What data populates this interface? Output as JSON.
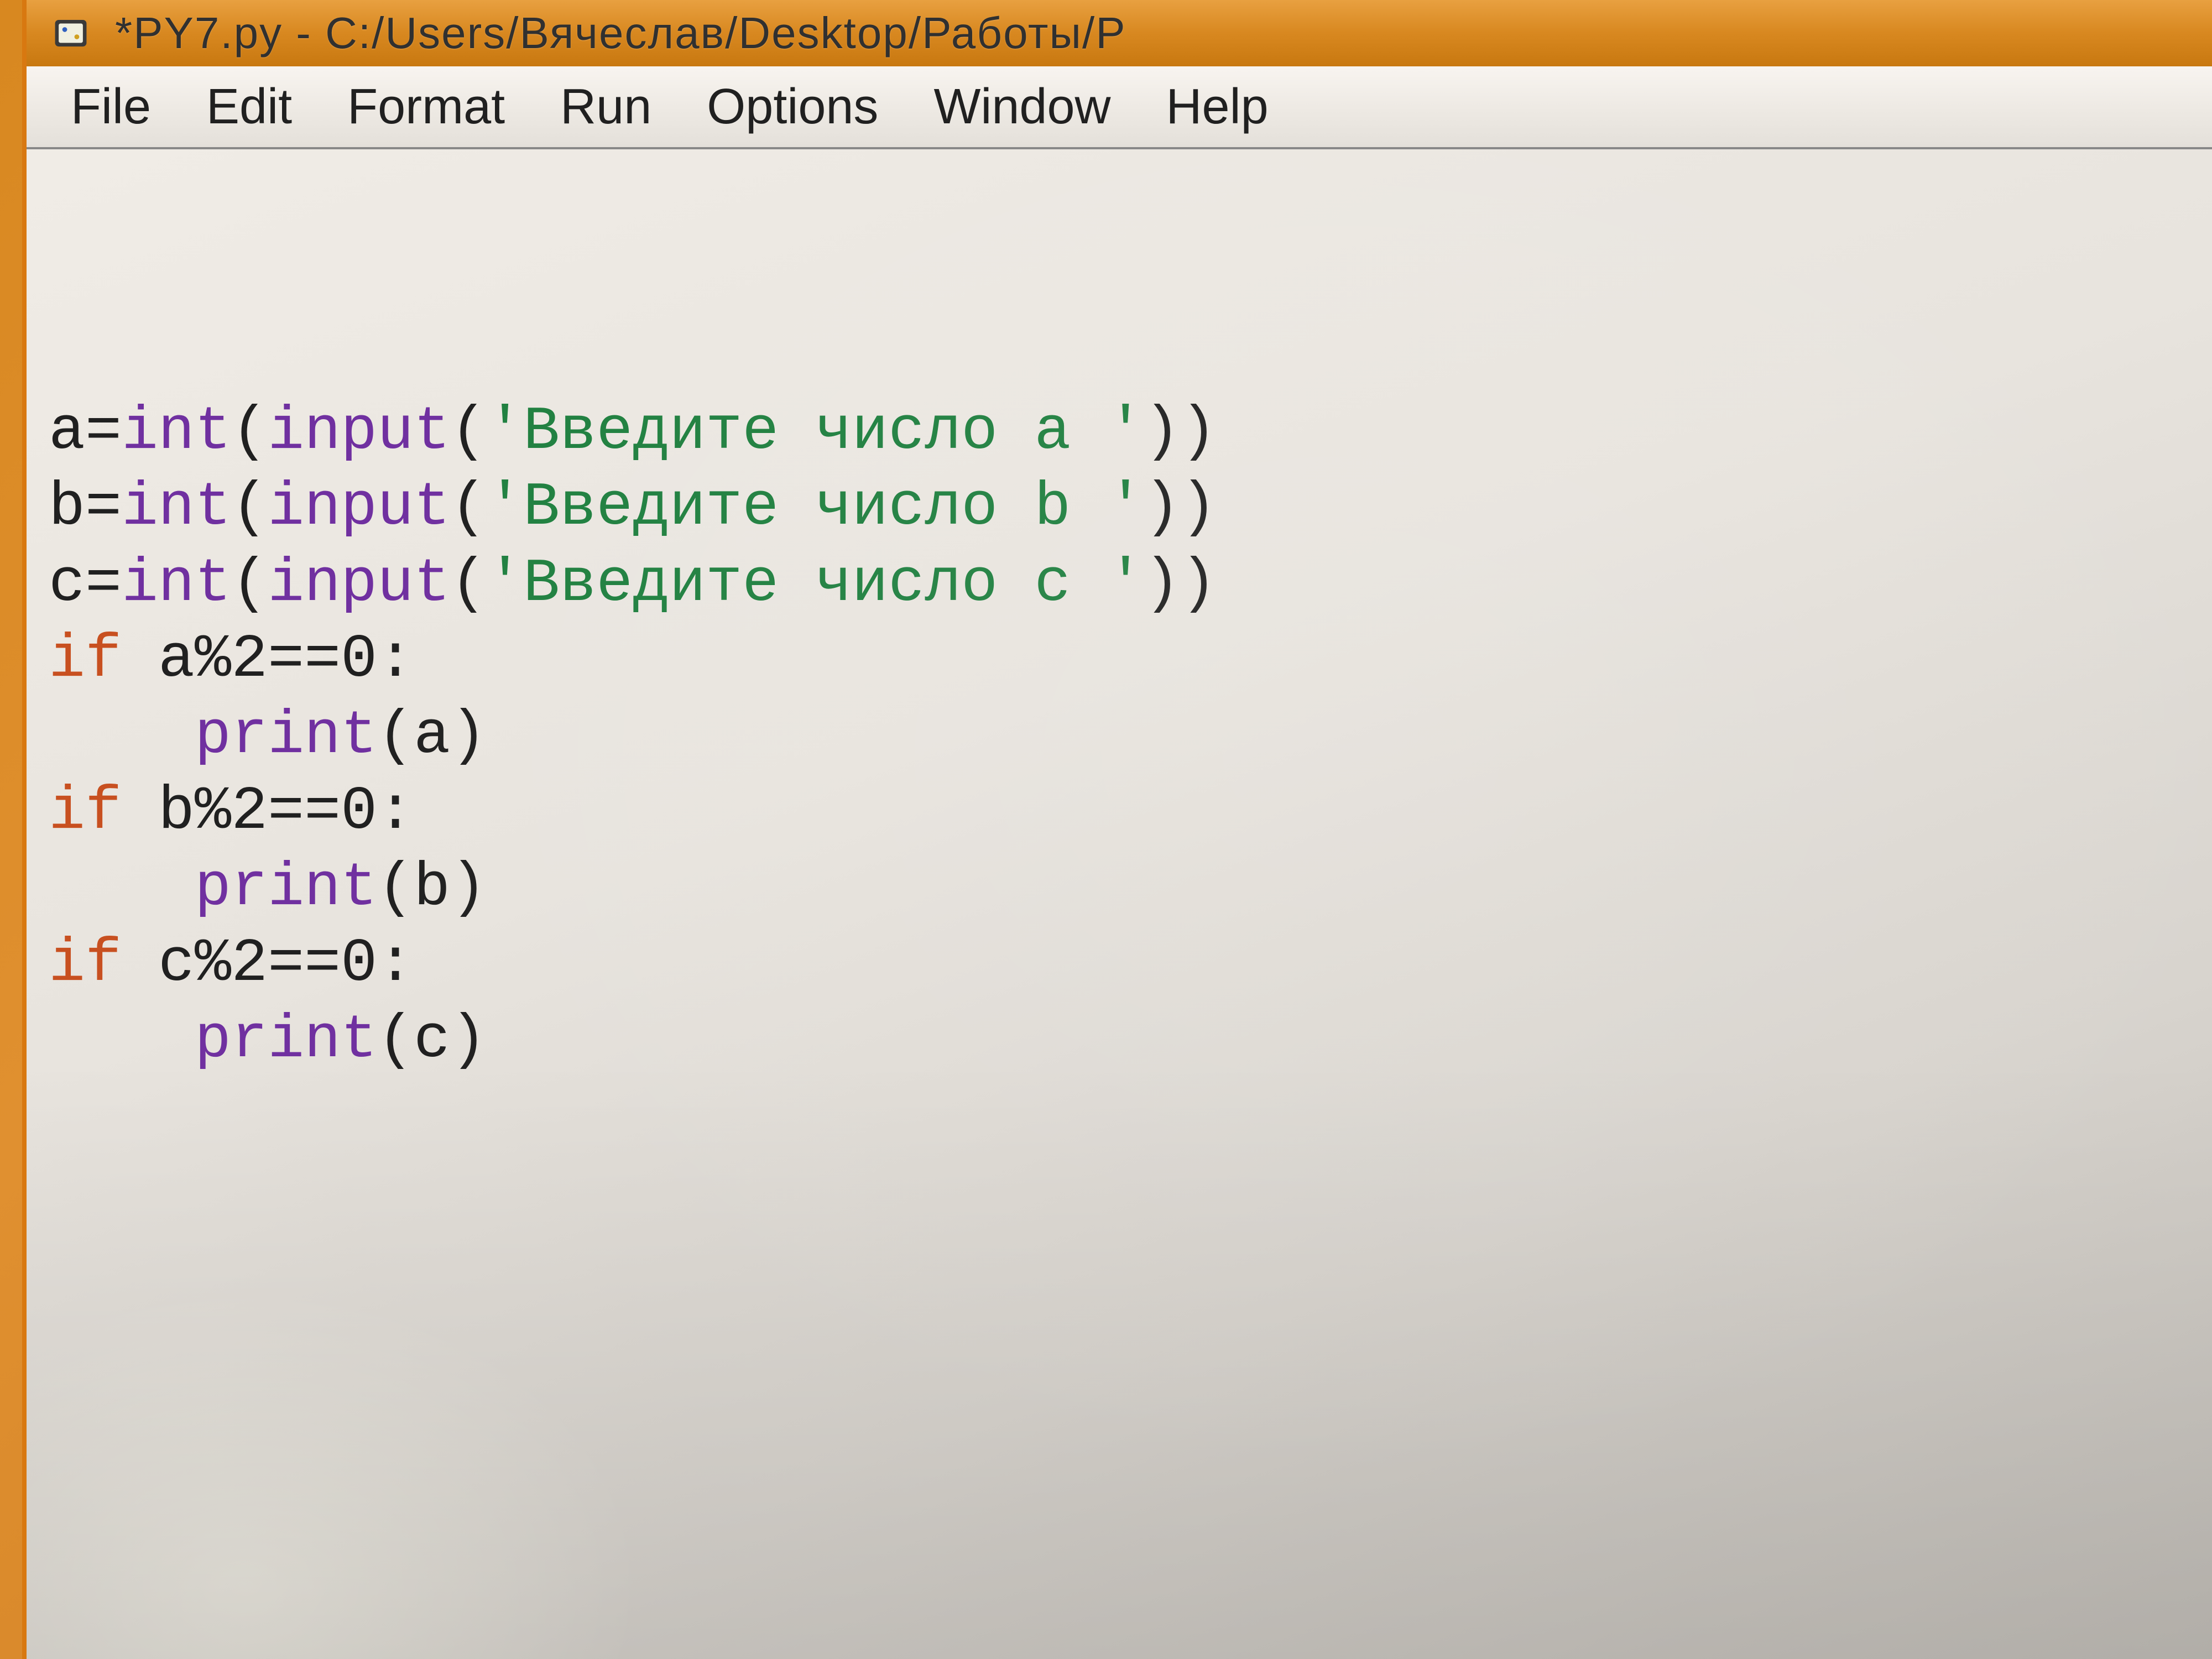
{
  "window": {
    "title": "*PY7.py - C:/Users/Вячеслав/Desktop/Работы/P"
  },
  "menubar": {
    "items": [
      "File",
      "Edit",
      "Format",
      "Run",
      "Options",
      "Window",
      "Help"
    ]
  },
  "code": {
    "lines": [
      {
        "tokens": [
          {
            "t": "plain",
            "v": "a="
          },
          {
            "t": "builtin",
            "v": "int"
          },
          {
            "t": "plain",
            "v": "("
          },
          {
            "t": "builtin",
            "v": "input"
          },
          {
            "t": "plain",
            "v": "("
          },
          {
            "t": "string",
            "v": "'Введите число a '"
          },
          {
            "t": "plain",
            "v": "))"
          }
        ]
      },
      {
        "tokens": [
          {
            "t": "plain",
            "v": "b="
          },
          {
            "t": "builtin",
            "v": "int"
          },
          {
            "t": "plain",
            "v": "("
          },
          {
            "t": "builtin",
            "v": "input"
          },
          {
            "t": "plain",
            "v": "("
          },
          {
            "t": "string",
            "v": "'Введите число b '"
          },
          {
            "t": "plain",
            "v": "))"
          }
        ]
      },
      {
        "tokens": [
          {
            "t": "plain",
            "v": "c="
          },
          {
            "t": "builtin",
            "v": "int"
          },
          {
            "t": "plain",
            "v": "("
          },
          {
            "t": "builtin",
            "v": "input"
          },
          {
            "t": "plain",
            "v": "("
          },
          {
            "t": "string",
            "v": "'Введите число c '"
          },
          {
            "t": "plain",
            "v": "))"
          }
        ]
      },
      {
        "tokens": [
          {
            "t": "kw",
            "v": "if"
          },
          {
            "t": "plain",
            "v": " a%2==0:"
          }
        ]
      },
      {
        "tokens": [
          {
            "t": "plain",
            "v": "    "
          },
          {
            "t": "builtin",
            "v": "print"
          },
          {
            "t": "plain",
            "v": "(a)"
          }
        ]
      },
      {
        "tokens": [
          {
            "t": "kw",
            "v": "if"
          },
          {
            "t": "plain",
            "v": " b%2==0:"
          }
        ]
      },
      {
        "tokens": [
          {
            "t": "plain",
            "v": "    "
          },
          {
            "t": "builtin",
            "v": "print"
          },
          {
            "t": "plain",
            "v": "(b)"
          }
        ]
      },
      {
        "tokens": [
          {
            "t": "kw",
            "v": "if"
          },
          {
            "t": "plain",
            "v": " c%2==0:"
          }
        ]
      },
      {
        "tokens": [
          {
            "t": "plain",
            "v": "    "
          },
          {
            "t": "builtin",
            "v": "print"
          },
          {
            "t": "plain",
            "v": "(c)"
          }
        ]
      }
    ]
  }
}
